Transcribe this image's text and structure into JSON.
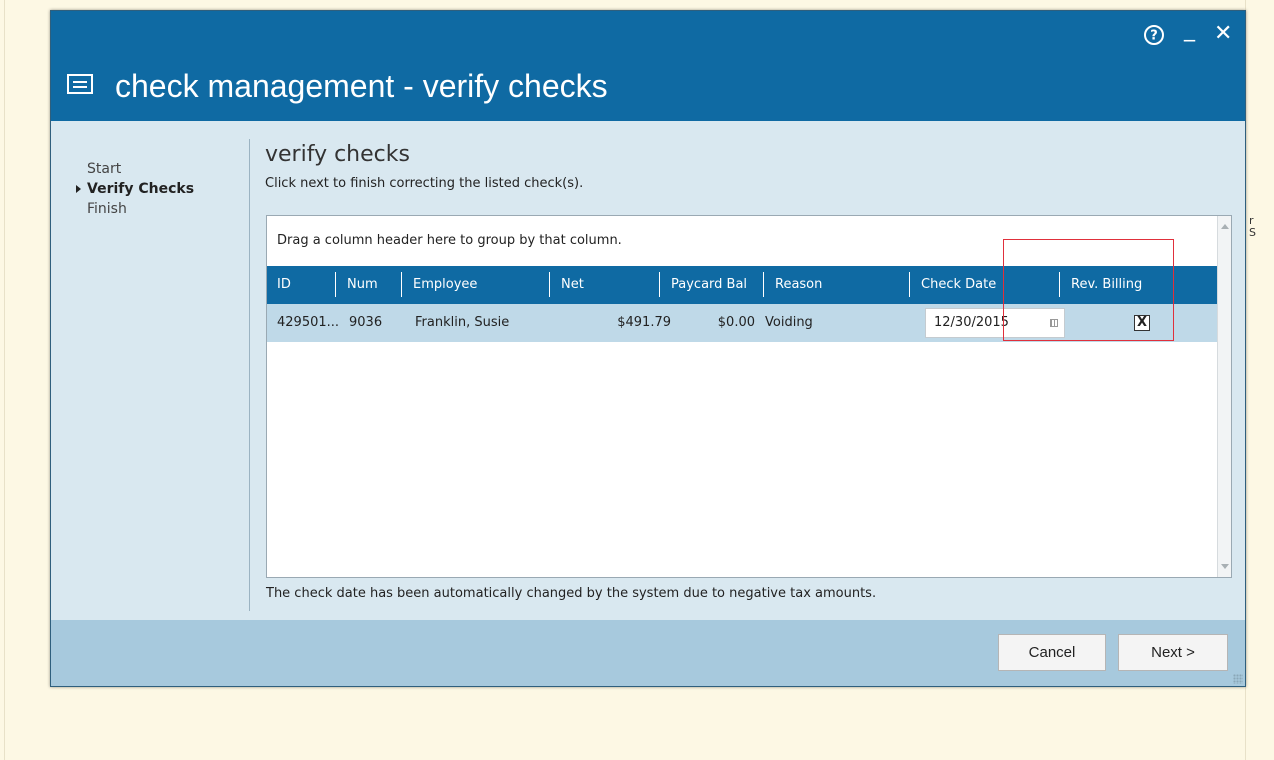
{
  "window": {
    "title": "check management - verify checks",
    "help_glyph": "?",
    "minimize_glyph": "_",
    "close_glyph": "✕"
  },
  "wizard_nav": {
    "items": [
      {
        "label": "Start",
        "active": false
      },
      {
        "label": "Verify Checks",
        "active": true
      },
      {
        "label": "Finish",
        "active": false
      }
    ]
  },
  "step": {
    "heading": "verify checks",
    "instructions": "Click next to finish correcting the listed check(s)."
  },
  "grid": {
    "group_hint": "Drag a column header here to group by that column.",
    "columns": [
      "ID",
      "Num",
      "Employee",
      "Net",
      "Paycard Bal",
      "Reason",
      "Check Date",
      "Rev. Billing"
    ],
    "rows": [
      {
        "id": "429501...",
        "num": "9036",
        "employee": "Franklin, Susie",
        "net": "$491.79",
        "paycard_bal": "$0.00",
        "reason": "Voiding",
        "check_date": "12/30/2015",
        "rev_billing": "X"
      }
    ]
  },
  "note": "The check date has been automatically changed by the system due to negative tax amounts.",
  "footer": {
    "cancel_label": "Cancel",
    "next_label": "Next >"
  },
  "side_hint": {
    "char1": "r",
    "char2": "S"
  },
  "colors": {
    "page_bg": "#fdf8e4",
    "title_bar": "#0f6aa3",
    "dialog_body": "#d9e8f0",
    "grid_header": "#0f6aa3",
    "selected_row": "#bfd9e8",
    "footer": "#a7c9dd",
    "highlight_box": "#e0303b"
  }
}
